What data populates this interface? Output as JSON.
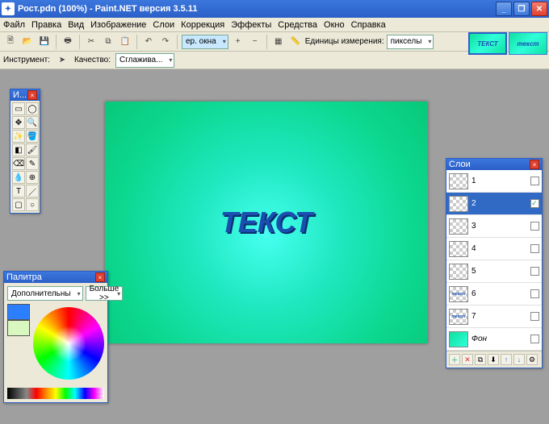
{
  "titlebar": {
    "title": "Рост.pdn (100%) - Paint.NET версия 3.5.11"
  },
  "menu": [
    "Файл",
    "Правка",
    "Вид",
    "Изображение",
    "Слои",
    "Коррекция",
    "Эффекты",
    "Средства",
    "Окно",
    "Справка"
  ],
  "toolbar": {
    "zoom_sel": "ер. окна",
    "units_label": "Единицы измерения:",
    "units_value": "пикселы"
  },
  "toolbar2": {
    "tool_label": "Инструмент:",
    "quality_label": "Качество:",
    "quality_value": "Сглажива..."
  },
  "thumbs": [
    {
      "label": "ТЕКСТ",
      "active": true
    },
    {
      "label": "текст",
      "active": false
    }
  ],
  "canvas": {
    "text": "ТЕКСТ"
  },
  "tools_panel": {
    "title": "И..."
  },
  "palette": {
    "title": "Палитра",
    "mode": "Дополнительны",
    "more": "Больше >>",
    "primary": "#2b7fff",
    "secondary": "#d8f8c0"
  },
  "layers": {
    "title": "Слои",
    "items": [
      {
        "name": "1",
        "visible": false,
        "bg": false,
        "mini": ""
      },
      {
        "name": "2",
        "visible": true,
        "bg": false,
        "mini": "",
        "selected": true
      },
      {
        "name": "3",
        "visible": false,
        "bg": false,
        "mini": ""
      },
      {
        "name": "4",
        "visible": false,
        "bg": false,
        "mini": ""
      },
      {
        "name": "5",
        "visible": false,
        "bg": false,
        "mini": ""
      },
      {
        "name": "6",
        "visible": false,
        "bg": false,
        "mini": "текст"
      },
      {
        "name": "7",
        "visible": false,
        "bg": false,
        "mini": "текст"
      },
      {
        "name": "Фон",
        "visible": false,
        "bg": true,
        "mini": "",
        "italic": true
      }
    ]
  }
}
